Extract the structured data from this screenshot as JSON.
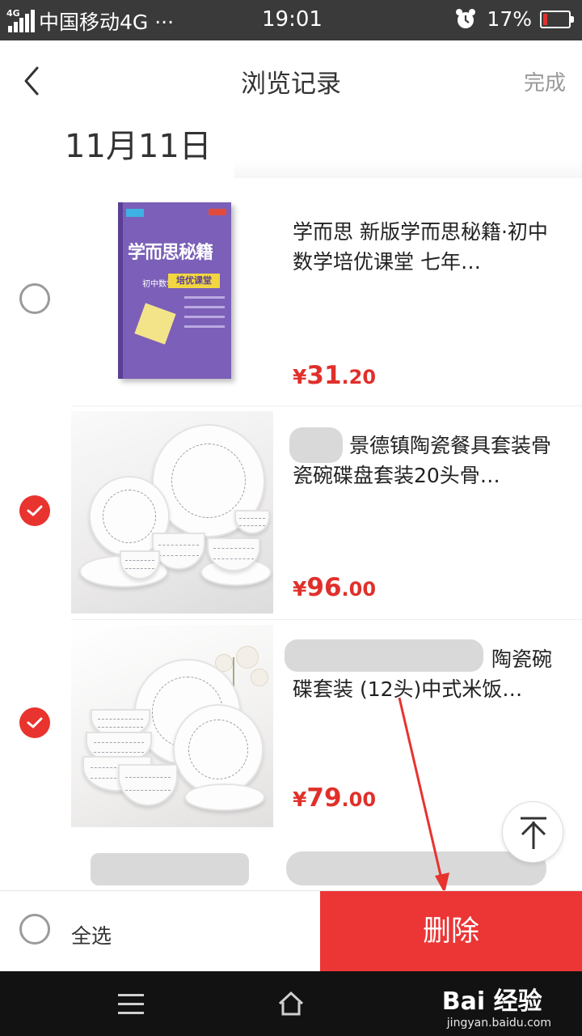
{
  "status_bar": {
    "network_tag": "4G",
    "carrier": "中国移动4G ···",
    "time": "19:01",
    "battery_percent": "17%",
    "battery_level": 0.17
  },
  "header": {
    "title": "浏览记录",
    "done_label": "完成"
  },
  "date_label": "11月11日",
  "items": [
    {
      "title": "学而思 新版学而思秘籍·初中数学培优课堂 七年…",
      "price_symbol": "¥",
      "price_int": "31",
      "price_dec": ".20",
      "checked": false,
      "cover_title": "学而思秘籍",
      "cover_subject": "初中数学",
      "cover_badge": "培优课堂"
    },
    {
      "title": "景德镇陶瓷餐具套装骨瓷碗碟盘套装20头骨…",
      "price_symbol": "¥",
      "price_int": "96",
      "price_dec": ".00",
      "checked": true
    },
    {
      "title": "陶瓷碗碟套装 (12头)中式米饭…",
      "price_symbol": "¥",
      "price_int": "79",
      "price_dec": ".00",
      "checked": true
    }
  ],
  "bottom_bar": {
    "select_all_label": "全选",
    "delete_label": "删除"
  },
  "nav": {
    "watermark_brand": "Bai 经验",
    "watermark_url": "jingyan.baidu.com"
  },
  "colors": {
    "accent": "#ec3535",
    "price": "#e0302b",
    "status_bar": "#3a3a3a"
  },
  "icons": [
    "back-icon",
    "alarm-icon",
    "battery-icon",
    "check-icon",
    "back-to-top-icon",
    "menu-icon",
    "home-icon"
  ]
}
